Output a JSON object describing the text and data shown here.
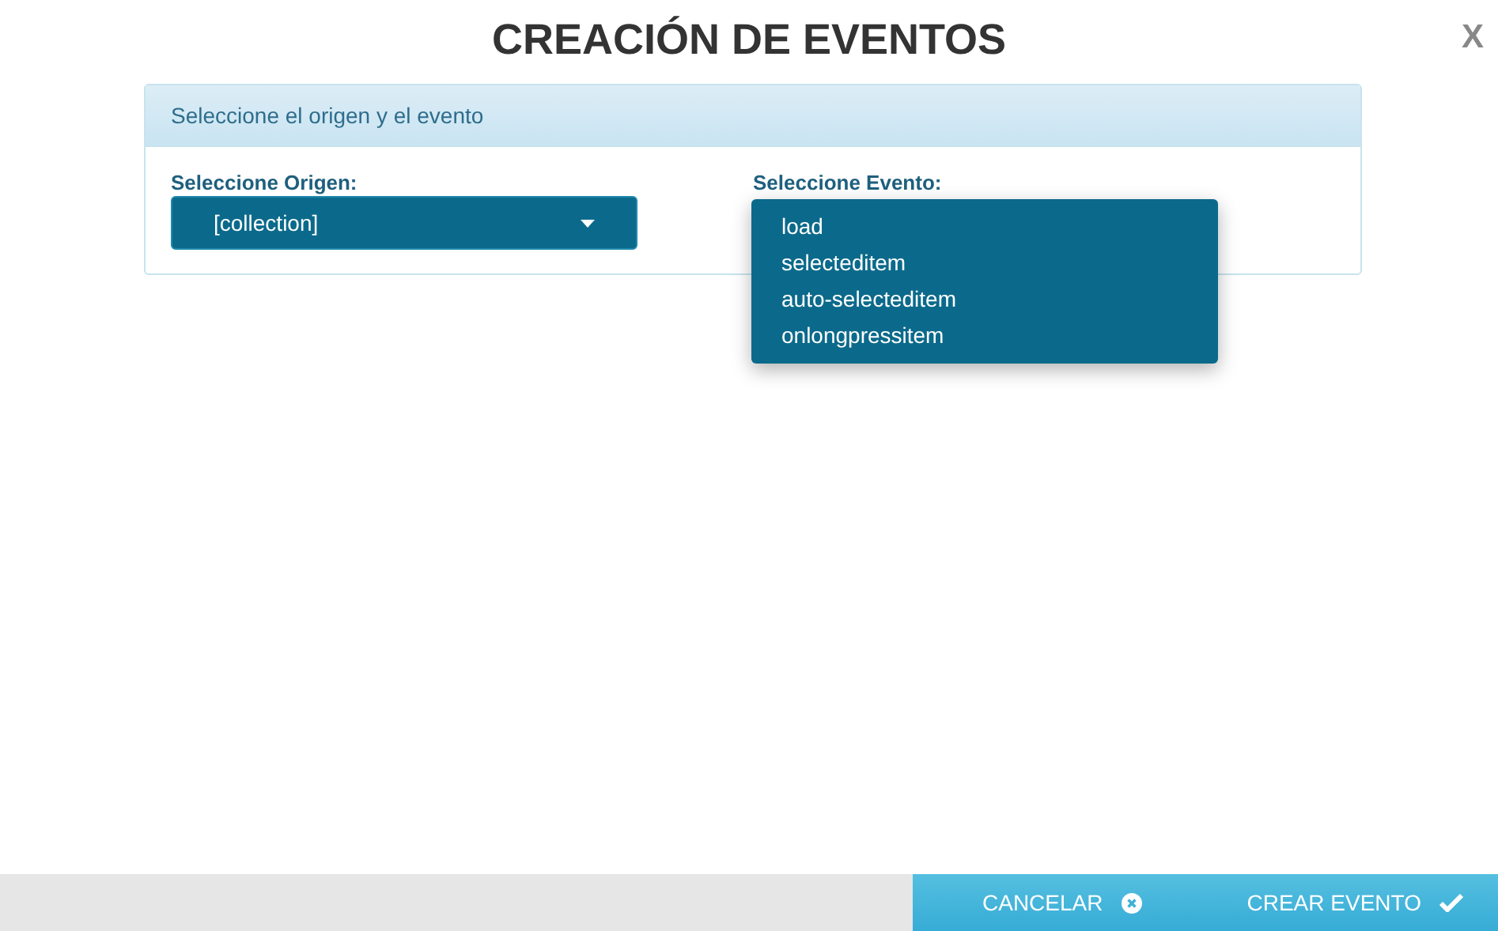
{
  "title": "CREACIÓN DE EVENTOS",
  "close": "X",
  "panel": {
    "header": "Seleccione el origen y el evento",
    "origin": {
      "label": "Seleccione Origen:",
      "value": "[collection]"
    },
    "event": {
      "label": "Seleccione Evento:",
      "options": [
        "load",
        "selecteditem",
        "auto-selecteditem",
        "onlongpressitem"
      ]
    }
  },
  "footer": {
    "cancel": "CANCELAR",
    "create": "CREAR EVENTO"
  }
}
